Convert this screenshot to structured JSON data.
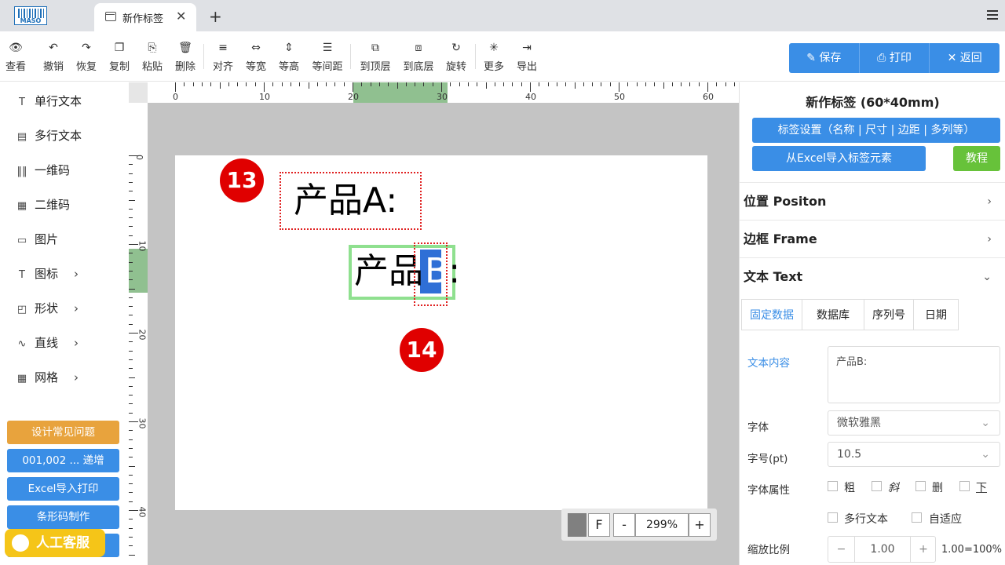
{
  "tabbar": {
    "logo_text": "MASO",
    "tab_title": "新作标签",
    "close": "✕",
    "new_tab": "+"
  },
  "toolbar": {
    "view": "查看",
    "undo": "撤销",
    "redo": "恢复",
    "copy": "复制",
    "paste": "粘贴",
    "delete": "删除",
    "align": "对齐",
    "same_width": "等宽",
    "same_height": "等高",
    "same_spacing": "等间距",
    "to_top": "到顶层",
    "to_bottom": "到底层",
    "rotate": "旋转",
    "more": "更多",
    "export": "导出",
    "save": "保存",
    "print": "打印",
    "back": "返回"
  },
  "sidebar": {
    "items": [
      "单行文本",
      "多行文本",
      "一维码",
      "二维码",
      "图片",
      "图标",
      "形状",
      "直线",
      "网格"
    ],
    "buttons": [
      "设计常见问题",
      "001,002 ... 递增",
      "Excel导入打印",
      "条形码制作"
    ],
    "kefu": "人工客服"
  },
  "canvas": {
    "ruler_h": [
      "0",
      "10",
      "20",
      "30",
      "40",
      "50",
      "60"
    ],
    "ruler_v": [
      "0",
      "10",
      "20",
      "30",
      "40"
    ],
    "elemA_text": "产品A:",
    "elemB_prefix": "产品",
    "elemB_selected": "B",
    "elemB_suffix": ":",
    "badge1": "13",
    "badge2": "14",
    "zoom": {
      "f": "F",
      "minus": "-",
      "value": "299%",
      "plus": "+"
    }
  },
  "panel": {
    "title": "新作标签 (60*40mm)",
    "settings_btn": "标签设置（名称 | 尺寸 | 边距 | 多列等）",
    "import_btn": "从Excel导入标签元素",
    "tutorial_btn": "教程",
    "sections": {
      "position": "位置 Positon",
      "frame": "边框 Frame",
      "text": "文本 Text"
    },
    "tabs": [
      "固定数据",
      "数据库",
      "序列号",
      "日期"
    ],
    "content_label": "文本内容",
    "content_value": "产品B:",
    "font_label": "字体",
    "font_value": "微软雅黑",
    "size_label": "字号(pt)",
    "size_value": "10.5",
    "attr_label": "字体属性",
    "attrs": [
      "粗",
      "斜",
      "删",
      "下"
    ],
    "multiline": "多行文本",
    "autofit": "自适应",
    "scale_label": "缩放比例",
    "scale_minus": "−",
    "scale_value": "1.00",
    "scale_plus": "+",
    "scale_note": "1.00=100%"
  },
  "colors": {
    "accent": "#3a8ee6",
    "orange": "#e8a33d",
    "green": "#67c23a",
    "badge": "#e00000",
    "select_frame": "#8fe08f"
  }
}
